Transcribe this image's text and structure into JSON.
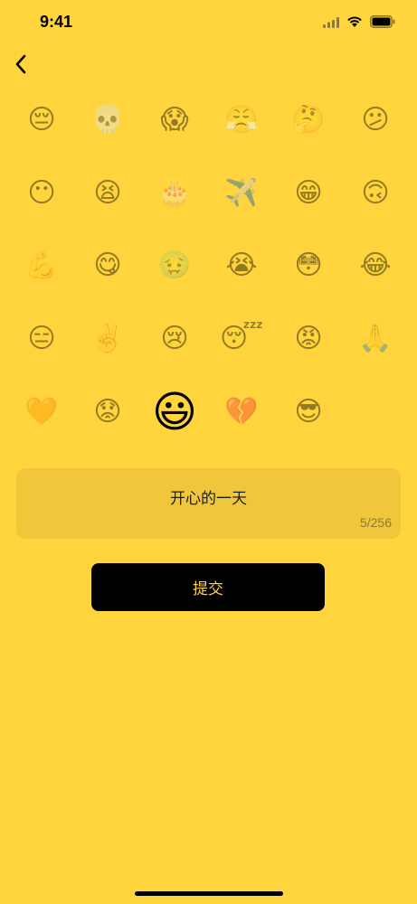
{
  "status_bar": {
    "time": "9:41",
    "icons": [
      "signal-icon",
      "wifi-icon",
      "battery-icon"
    ]
  },
  "back": {
    "icon": "chevron-left-icon"
  },
  "emojis": [
    {
      "char": "😔",
      "name": "pensive-face"
    },
    {
      "char": "💀",
      "name": "skull"
    },
    {
      "char": "😱",
      "name": "screaming-face"
    },
    {
      "char": "😤",
      "name": "huffing-face"
    },
    {
      "char": "🤔",
      "name": "thinking-face"
    },
    {
      "char": "😕",
      "name": "confused-face"
    },
    {
      "char": "😶",
      "name": "face-without-mouth"
    },
    {
      "char": "😫",
      "name": "tired-face"
    },
    {
      "char": "🎂",
      "name": "birthday-cake"
    },
    {
      "char": "✈️",
      "name": "airplane"
    },
    {
      "char": "😁",
      "name": "beaming-face"
    },
    {
      "char": "🙃",
      "name": "upside-down-face"
    },
    {
      "char": "💪",
      "name": "flexed-biceps"
    },
    {
      "char": "😋",
      "name": "savoring-face"
    },
    {
      "char": "🤢",
      "name": "nauseated-face"
    },
    {
      "char": "😭",
      "name": "loudly-crying-face"
    },
    {
      "char": "😳",
      "name": "flushed-face"
    },
    {
      "char": "😂",
      "name": "tears-of-joy-face"
    },
    {
      "char": "😑",
      "name": "expressionless-face"
    },
    {
      "char": "✌️",
      "name": "victory-hand"
    },
    {
      "char": "😢",
      "name": "crying-face"
    },
    {
      "char": "😴",
      "name": "sleeping-face"
    },
    {
      "char": "😡",
      "name": "pouting-face"
    },
    {
      "char": "🙏",
      "name": "folded-hands"
    },
    {
      "char": "🧡",
      "name": "orange-heart"
    },
    {
      "char": "😟",
      "name": "worried-face"
    },
    {
      "char": "😃",
      "name": "grinning-face",
      "selected": true
    },
    {
      "char": "💔",
      "name": "broken-heart"
    },
    {
      "char": "😎",
      "name": "sunglasses-face"
    }
  ],
  "note": {
    "text": "开心的一天",
    "count": "5/256"
  },
  "submit": {
    "label": "提交"
  },
  "colors": {
    "background": "#FFD43C",
    "input_bg": "#F0C73A",
    "button_bg": "#000000",
    "button_text": "#FFD43C"
  }
}
